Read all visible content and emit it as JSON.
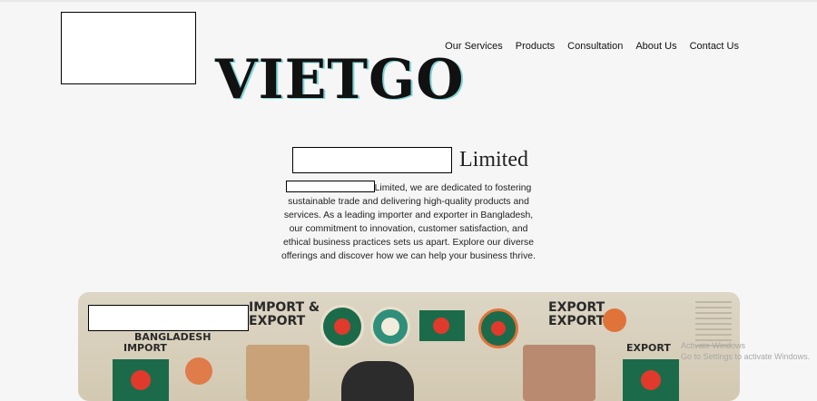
{
  "header": {
    "brand": "VIETGO",
    "nav": [
      "Our Services",
      "Products",
      "Consultation",
      "About Us",
      "Contact Us"
    ]
  },
  "hero": {
    "company_suffix": "Limited",
    "intro_prefix": "Limited, we are dedicated to fostering sustainable trade and delivering high-quality products and services. As a leading importer and exporter in Bangladesh, our commitment to innovation, customer satisfaction, and ethical business practices sets us apart. Explore our diverse offerings and discover how we can help your business thrive."
  },
  "banner": {
    "left_title": "IMPORT & EXPORT",
    "left_sub_1": "BANGLADESH",
    "left_sub_2": "IMPORT",
    "right_title": "EXPORT EXPORT",
    "right_sub": "EXPORT"
  },
  "watermark": {
    "line1": "Activate Windows",
    "line2": "Go to Settings to activate Windows."
  },
  "colors": {
    "flag_green": "#1b6b4a",
    "flag_red": "#e03a2c",
    "banner_bg": "#d8d0bd"
  }
}
